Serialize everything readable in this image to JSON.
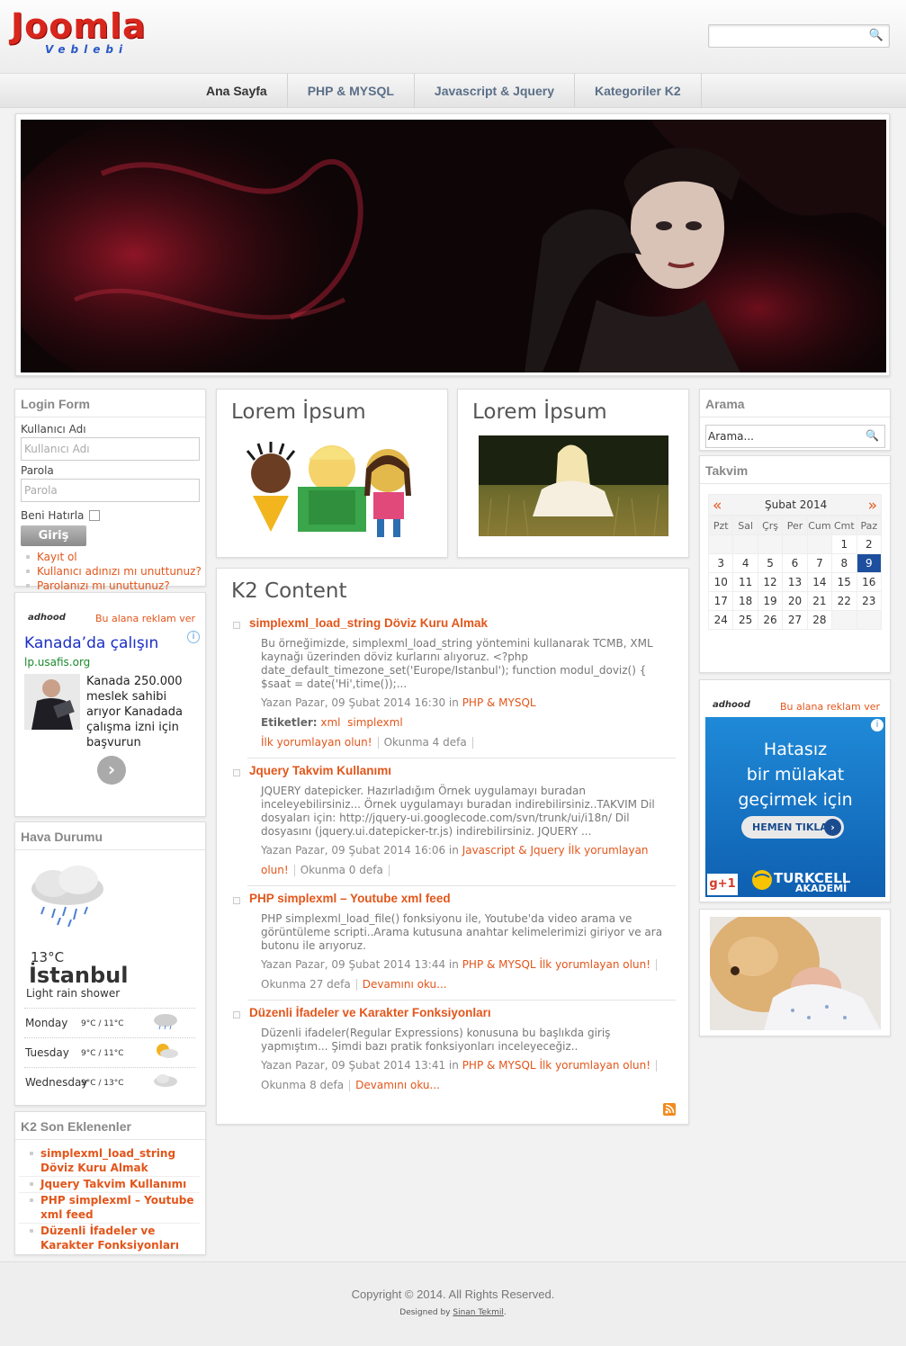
{
  "logo": {
    "main": "Joomla",
    "sub": "Veblebi"
  },
  "nav": {
    "items": [
      "Ana Sayfa",
      "PHP & MYSQL",
      "Javascript & Jquery",
      "Kategoriler K2"
    ]
  },
  "login": {
    "title": "Login Form",
    "user_label": "Kullanıcı Adı",
    "user_placeholder": "Kullanıcı Adı",
    "pass_label": "Parola",
    "pass_placeholder": "Parola",
    "remember": "Beni Hatırla",
    "submit": "Giriş",
    "links": [
      "Kayıt ol",
      "Kullanıcı adınızı mı unuttunuz?",
      "Parolanızı mı unuttunuz?"
    ]
  },
  "ad_left": {
    "brand": "adhood",
    "cta": "Bu alana reklam ver",
    "headline": "Kanada’da çalışın",
    "url": "lp.usafis.org",
    "text": "Kanada 250.000 meslek sahibi arıyor Kanadada çalışma izni için başvurun"
  },
  "weather": {
    "title": "Hava Durumu",
    "temp": "13°C",
    "city": "İstanbul",
    "desc": "Light rain shower",
    "days": [
      {
        "day": "Monday",
        "temp": "9°C / 11°C"
      },
      {
        "day": "Tuesday",
        "temp": "9°C / 11°C"
      },
      {
        "day": "Wednesday",
        "temp": "9°C / 13°C"
      }
    ]
  },
  "k2latest": {
    "title": "K2 Son Eklenenler",
    "items": [
      "simplexml_load_string Döviz Kuru Almak",
      "Jquery Takvim Kullanımı",
      "PHP simplexml – Youtube xml feed",
      "Düzenli İfadeler ve Karakter Fonksiyonları"
    ]
  },
  "lorem": {
    "a": "Lorem İpsum",
    "b": "Lorem İpsum"
  },
  "k2": {
    "title": "K2 Content",
    "articles": [
      {
        "title": "simplexml_load_string Döviz Kuru Almak",
        "text": "Bu örneğimizde, simplexml_load_string yöntemini kullanarak TCMB, XML kaynağı üzerinden döviz kurlarını alıyoruz. <?php date_default_timezone_set('Europe/Istanbul'); function modul_doviz() { $saat = date('Hi',time());...",
        "meta": "Yazan Pazar, 09 Şubat 2014 16:30 in",
        "cat": "PHP & MYSQL",
        "tags_label": "Etiketler:",
        "tags": [
          "xml",
          "simplexml"
        ],
        "comment": "İlk yorumlayan olun!",
        "reads": "Okunma 4 defa"
      },
      {
        "title": "Jquery Takvim Kullanımı",
        "text": "JQUERY datepicker. Hazırladığım Örnek uygulamayı buradan inceleyebilirsiniz... Örnek uygulamayı buradan indirebilirsiniz..TAKVIM Dil dosyaları için: http://jquery-ui.googlecode.com/svn/trunk/ui/i18n/ Dil dosyasını (jquery.ui.datepicker-tr.js) indirebilirsiniz. JQUERY ...",
        "meta": "Yazan Pazar, 09 Şubat 2014 16:06 in",
        "cat": "Javascript & Jquery",
        "comment": "İlk yorumlayan olun!",
        "reads": "Okunma 0 defa"
      },
      {
        "title": "PHP simplexml – Youtube xml feed",
        "text": "PHP simplexml_load_file() fonksiyonu ile, Youtube'da video arama ve görüntüleme scripti..Arama kutusuna anahtar kelimelerimizi giriyor ve ara butonu ile arıyoruz.",
        "meta": "Yazan Pazar, 09 Şubat 2014 13:44 in",
        "cat": "PHP & MYSQL",
        "comment": "İlk yorumlayan olun!",
        "reads": "Okunma 27 defa",
        "more": "Devamını oku..."
      },
      {
        "title": "Düzenli İfadeler ve Karakter Fonksiyonları",
        "text": "Düzenli ifadeler(Regular Expressions) konusuna bu başlıkda giriş yapmıştım... Şimdi bazı pratik fonksiyonları inceleyeceğiz..",
        "meta": "Yazan Pazar, 09 Şubat 2014 13:41 in",
        "cat": "PHP & MYSQL",
        "comment": "İlk yorumlayan olun!",
        "reads": "Okunma 8 defa",
        "more": "Devamını oku..."
      }
    ]
  },
  "search": {
    "title": "Arama",
    "placeholder": "Arama..."
  },
  "calendar": {
    "title": "Takvim",
    "month": "Şubat 2014",
    "prev": "«",
    "next": "»",
    "headers": [
      "Pzt",
      "Sal",
      "Çrş",
      "Per",
      "Cum",
      "Cmt",
      "Paz"
    ],
    "today": "9",
    "weeks": [
      [
        "",
        "",
        "",
        "",
        "",
        "1",
        "2"
      ],
      [
        "3",
        "4",
        "5",
        "6",
        "7",
        "8",
        "9"
      ],
      [
        "10",
        "11",
        "12",
        "13",
        "14",
        "15",
        "16"
      ],
      [
        "17",
        "18",
        "19",
        "20",
        "21",
        "22",
        "23"
      ],
      [
        "24",
        "25",
        "26",
        "27",
        "28",
        "",
        ""
      ]
    ]
  },
  "ad_right": {
    "brand": "adhood",
    "cta": "Bu alana reklam ver",
    "line1": "Hatasız",
    "line2": "bir mülakat",
    "line3": "geçirmek için",
    "button": "HEMEN TIKLA",
    "gplus": "g+1",
    "sponsor1": "TURKCELL",
    "sponsor2": "AKADEMİ"
  },
  "footer": {
    "copyright": "Copyright © 2014. All Rights Reserved.",
    "designed": "Designed by",
    "designer": "Sinan Tekmil",
    "dot": "."
  }
}
